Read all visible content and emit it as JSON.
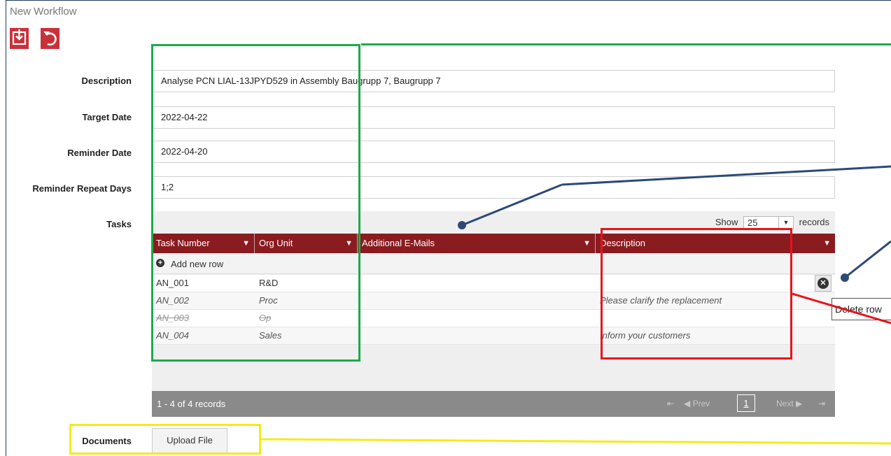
{
  "window": {
    "title": "New Workflow"
  },
  "toolbar": {
    "save_icon": "save-icon",
    "undo_icon": "undo-icon",
    "accent": "#c9313a"
  },
  "form": {
    "description_label": "Description",
    "description_value": "Analyse PCN LIAL-13JPYD529 in Assembly Baugrupp 7, Baugrupp 7",
    "target_date_label": "Target Date",
    "target_date_value": "2022-04-22",
    "reminder_date_label": "Reminder Date",
    "reminder_date_value": "2022-04-20",
    "reminder_repeat_label": "Reminder Repeat Days",
    "reminder_repeat_value": "1;2",
    "tasks_label": "Tasks",
    "documents_label": "Documents",
    "upload_label": "Upload File"
  },
  "grid": {
    "show_label": "Show",
    "page_size": "25",
    "records_label": "records",
    "header_color": "#8a1b1f",
    "columns": [
      "Task Number",
      "Org Unit",
      "Additional E-Mails",
      "Description"
    ],
    "add_row_label": "Add new row",
    "rows": [
      {
        "task": "AN_001",
        "org": "R&D",
        "emails": "",
        "desc": "",
        "style": "normal"
      },
      {
        "task": "AN_002",
        "org": "Proc",
        "emails": "",
        "desc": "Please clarify the replacement",
        "style": "italic"
      },
      {
        "task": "AN_003",
        "org": "Op",
        "emails": "",
        "desc": "",
        "style": "deleted"
      },
      {
        "task": "AN_004",
        "org": "Sales",
        "emails": "",
        "desc": "Inform your customers",
        "style": "italic"
      }
    ],
    "footer": {
      "count": "1 - 4 of 4 records",
      "first": "⇤",
      "prev": "◀ Prev",
      "page": "1",
      "next": "Next ▶",
      "last": "⇥"
    },
    "delete_tooltip": "Delete row"
  },
  "annotations": {
    "green": "#1aab4b",
    "red": "#e8141b",
    "yellow": "#f2ec1a",
    "navy": "#2c4a78"
  }
}
